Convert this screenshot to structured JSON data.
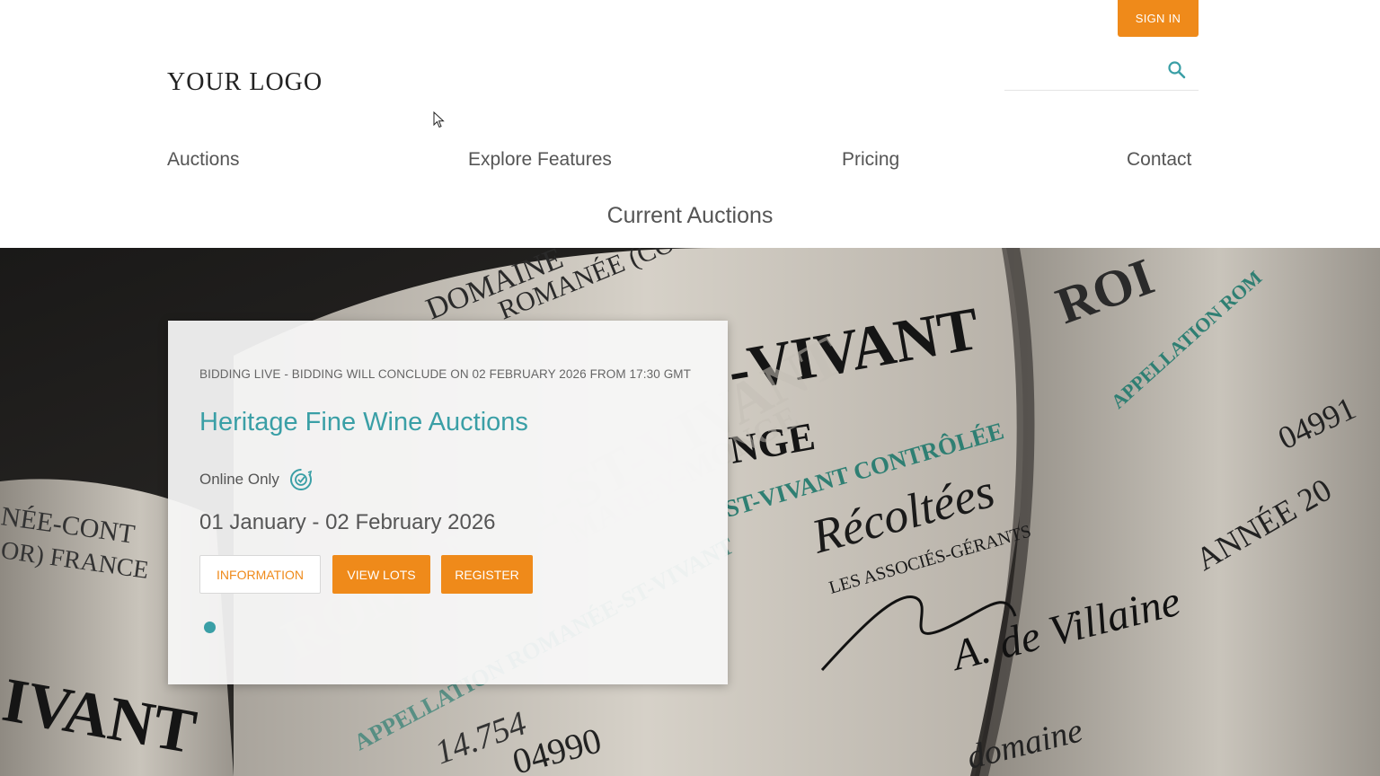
{
  "header": {
    "sign_in_label": "SIGN IN",
    "logo_text": "YOUR LOGO",
    "search": {
      "placeholder": "",
      "value": "",
      "icon": "search-icon"
    }
  },
  "nav": {
    "items": [
      {
        "label": "Auctions"
      },
      {
        "label": "Explore Features"
      },
      {
        "label": "Pricing"
      },
      {
        "label": "Contact"
      }
    ]
  },
  "main": {
    "section_title": "Current Auctions",
    "auction": {
      "status": "BIDDING LIVE - BIDDING WILL CONCLUDE ON 02 FEBRUARY 2026 FROM 17:30 GMT",
      "title": "Heritage Fine Wine Auctions",
      "location": "Online Only",
      "location_icon": "online-bidding-icon",
      "dates": "01 January - 02 February 2026",
      "buttons": {
        "information": "INFORMATION",
        "view_lots": "VIEW LOTS",
        "register": "REGISTER"
      },
      "carousel": {
        "slides": 1,
        "active": 1
      }
    },
    "hero_image": {
      "description_icon": "wine-labels-photo",
      "label_texts": [
        "DOMAINE",
        "ROMANÉE (CO",
        "-VIVANT",
        "NGE",
        "ST-VIVANT CONTRÔLÉE",
        "Récoltées",
        "LES ASSOCIÉS-GÉRANTS",
        "A. de Villaine",
        "domaine",
        "ROMANÉE-ST-VIVANT",
        "MAREY-MONGE",
        "APPELLATION ROMANÉE-ST-VIVANT",
        "14.754",
        "04990",
        "ROI",
        "APPELLATION ROM",
        "04991",
        "ANNÉE 20",
        "NÉE-CONT",
        "OR) FRANCE",
        "IVANT"
      ]
    }
  },
  "colors": {
    "accent_orange": "#ef8a1a",
    "accent_teal": "#3a9fa6",
    "text": "#555555"
  }
}
